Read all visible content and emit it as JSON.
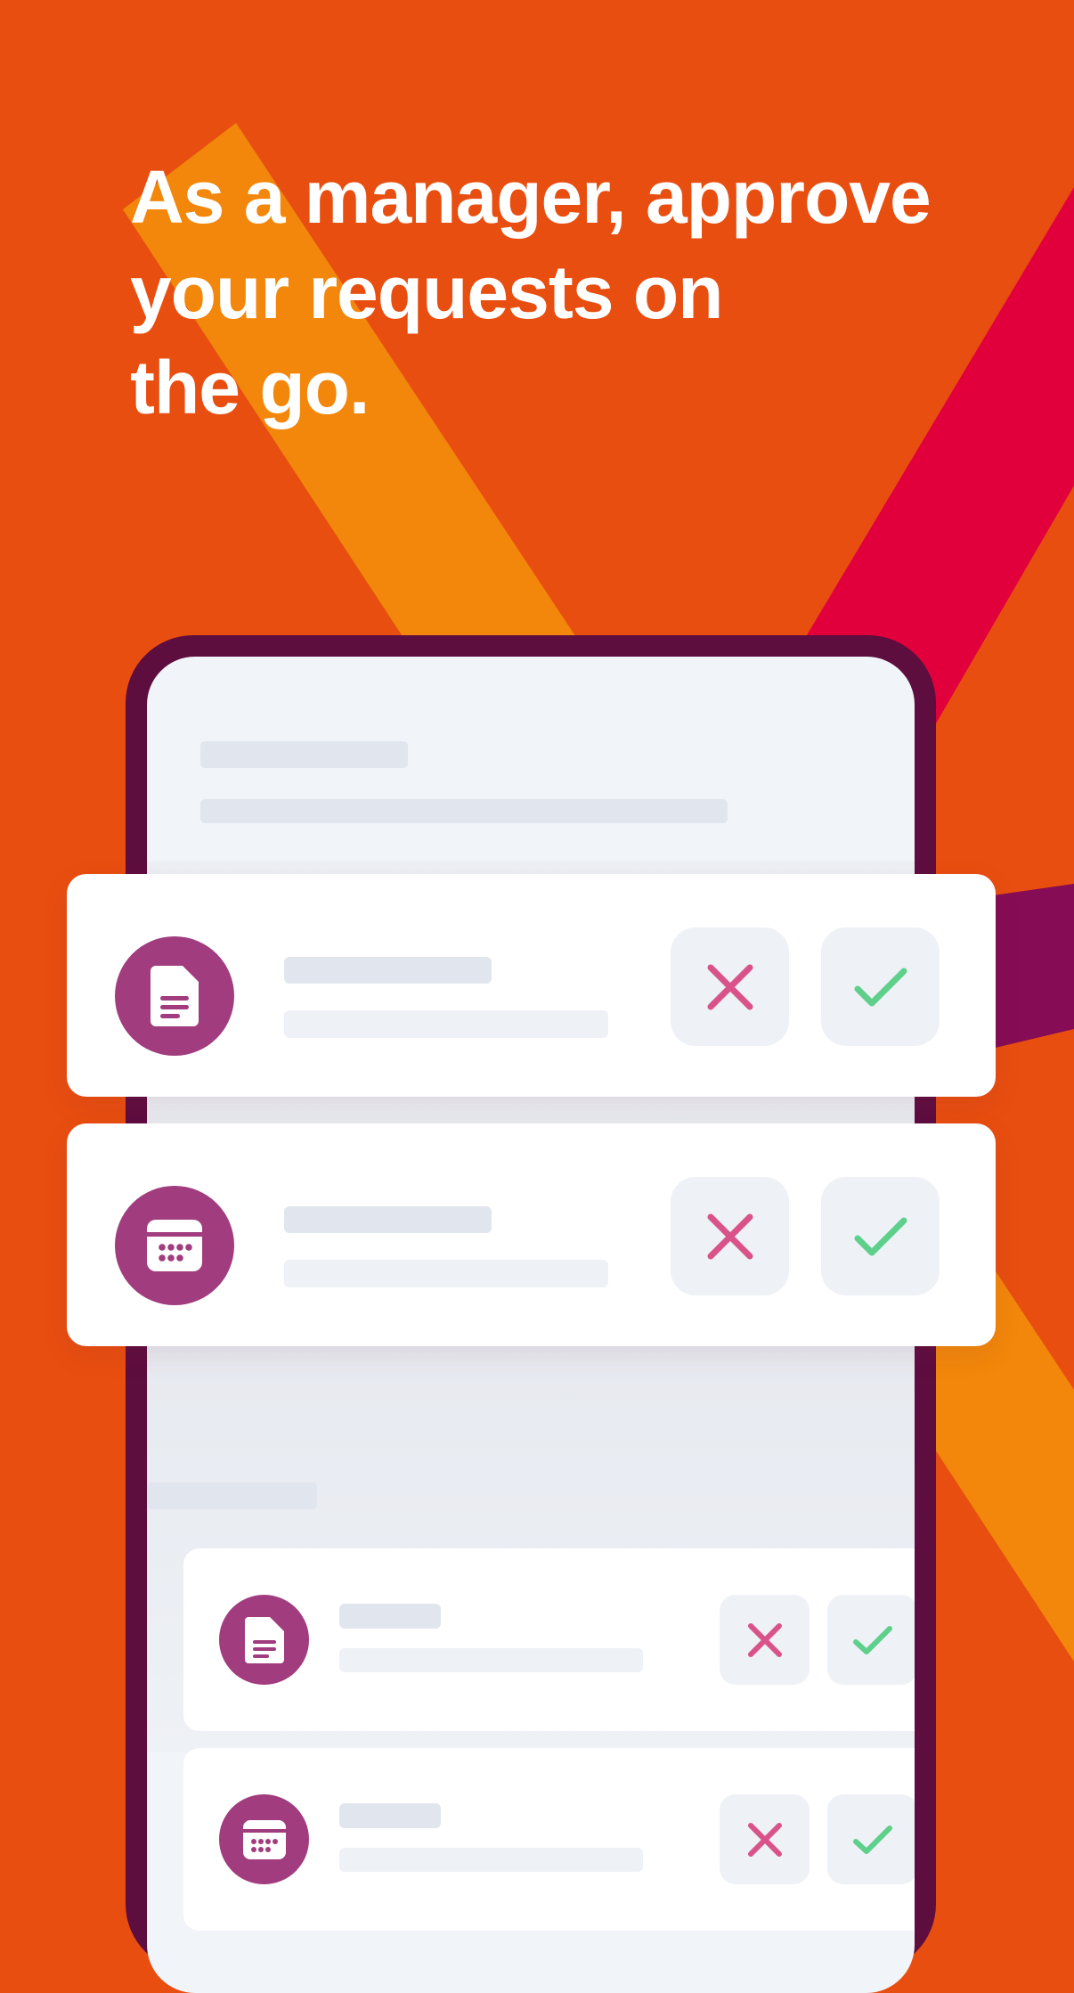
{
  "headline": {
    "line1": "As a manager, approve",
    "line2": "your requests on",
    "line3": "the go."
  },
  "colors": {
    "background": "#E84E10",
    "stripe_orange": "#F2870B",
    "stripe_red": "#E2003C",
    "stripe_purple": "#860C55",
    "phone_frame": "#5E0D3F",
    "avatar": "#A13C7E",
    "reject": "#D9538A",
    "approve": "#5FD08B"
  },
  "icons": {
    "document": "document-icon",
    "calendar": "calendar-icon",
    "reject": "x-icon",
    "approve": "check-icon"
  },
  "requests": [
    {
      "type": "document",
      "reject_label": "Reject",
      "approve_label": "Approve"
    },
    {
      "type": "calendar",
      "reject_label": "Reject",
      "approve_label": "Approve"
    },
    {
      "type": "document",
      "reject_label": "Reject",
      "approve_label": "Approve"
    },
    {
      "type": "calendar",
      "reject_label": "Reject",
      "approve_label": "Approve"
    }
  ]
}
